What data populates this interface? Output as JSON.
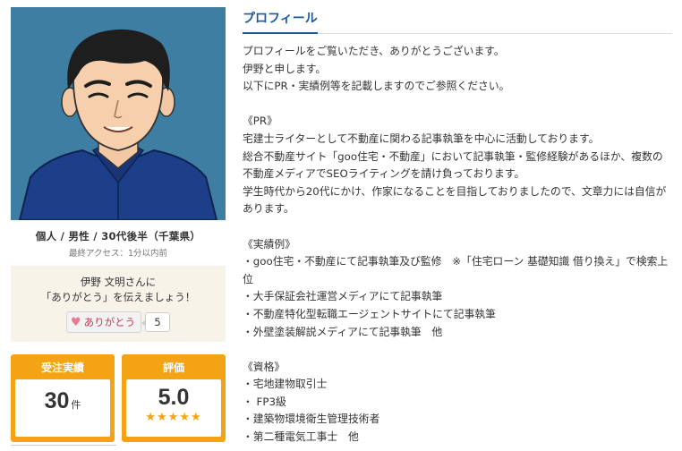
{
  "profile": {
    "attributes": "個人 / 男性 / 30代後半（千葉県）",
    "last_access": "最終アクセス：1分以内前"
  },
  "thanks": {
    "line1": "伊野 文明さんに",
    "line2": "「ありがとう」を伝えましょう！",
    "button_label": "ありがとう",
    "count": "5"
  },
  "stats": {
    "orders": {
      "label": "受注実績",
      "value": "30",
      "unit": "件"
    },
    "rating": {
      "label": "評価",
      "value": "5.0",
      "stars": "★★★★★"
    }
  },
  "tab": {
    "title": "プロフィール"
  },
  "content": {
    "body": "プロフィールをご覧いただき、ありがとうございます。\n伊野と申します。\n以下にPR・実績例等を記載しますのでご参照ください。\n\n《PR》\n宅建士ライターとして不動産に関わる記事執筆を中心に活動しております。\n総合不動産サイト「goo住宅・不動産」において記事執筆・監修経験があるほか、複数の不動産メディアでSEOライティングを請け負っております。\n学生時代から20代にかけ、作家になることを目指しておりましたので、文章力には自信があります。\n\n《実績例》\n・goo住宅・不動産にて記事執筆及び監修　※「住宅ローン 基礎知識 借り換え」で検索上位\n・大手保証会社運営メディアにて記事執筆\n・不動産特化型転職エージェントサイトにて記事執筆\n・外壁塗装解説メディアにて記事執筆　他\n\n《資格》\n・宅地建物取引士\n・ FP3級\n・建築物環境衛生管理技術者\n・第二種電気工事士　他"
  },
  "colors": {
    "accent_orange": "#f4a314",
    "accent_blue": "#1a5a9a",
    "avatar_bg": "#3f7ea3"
  }
}
